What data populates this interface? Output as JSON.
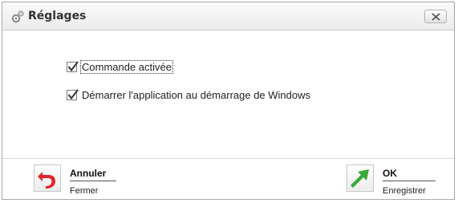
{
  "window": {
    "title": "Réglages",
    "title_icon": "gears-icon",
    "close_icon": "close-icon"
  },
  "options": [
    {
      "label": "Commande activée",
      "checked": true
    },
    {
      "label": "Démarrer l'application au démarrage de Windows",
      "checked": true
    }
  ],
  "actions": {
    "cancel": {
      "title": "Annuler",
      "subtitle": "Fermer",
      "icon": "undo-arrow-icon",
      "color": "#e0262c"
    },
    "ok": {
      "title": "OK",
      "subtitle": "Enregistrer",
      "icon": "ok-arrow-icon",
      "color": "#3aa83a"
    }
  }
}
